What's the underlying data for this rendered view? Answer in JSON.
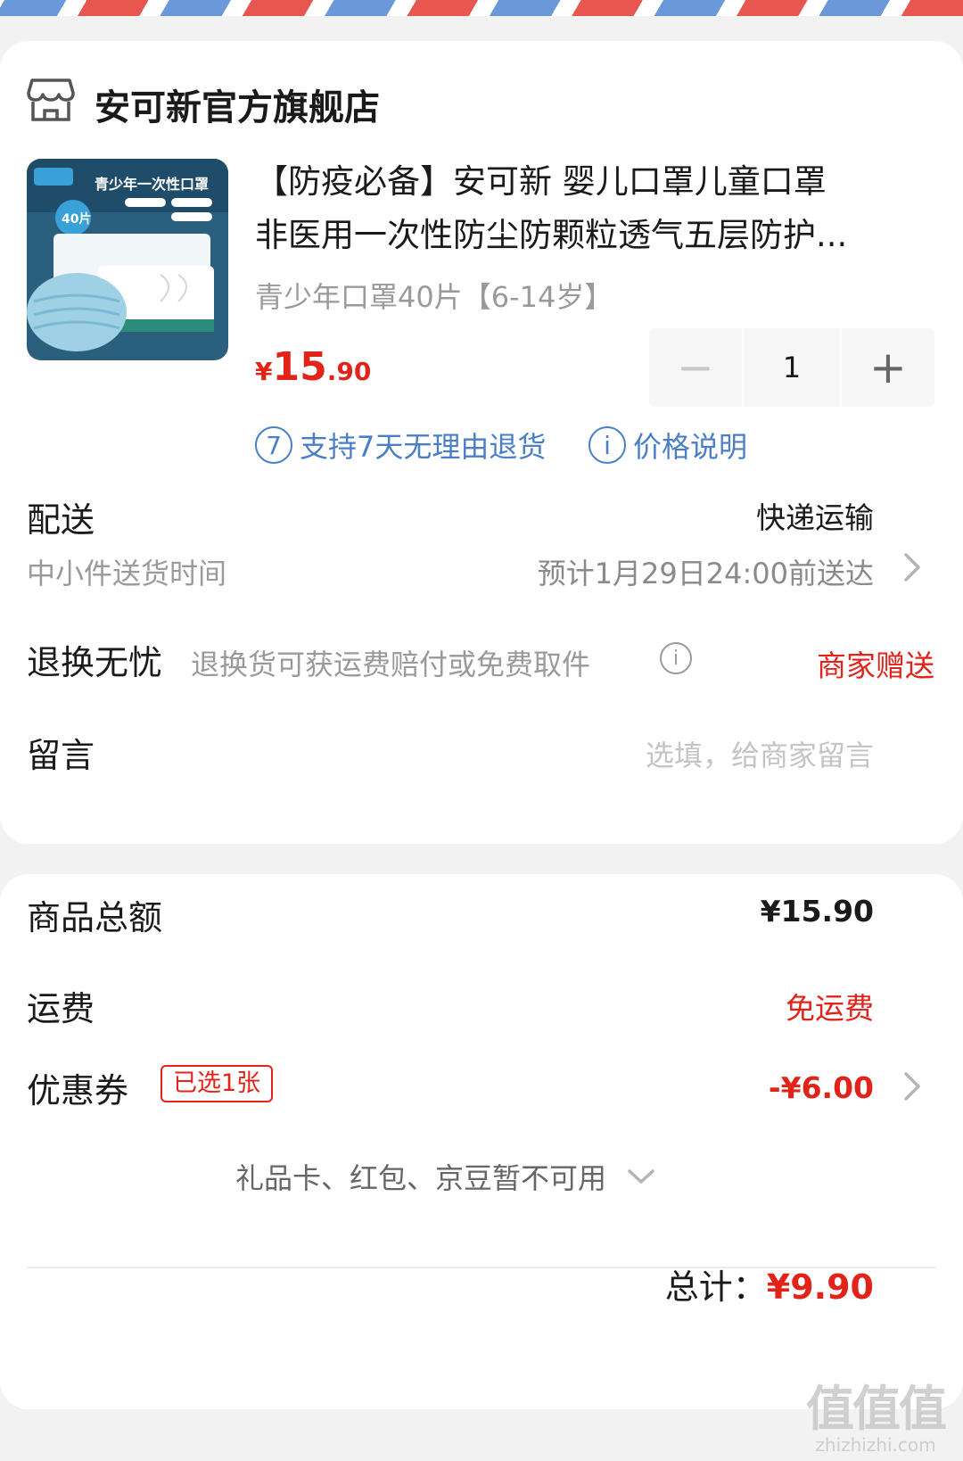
{
  "shop": {
    "name": "安可新官方旗舰店",
    "icon": "store-icon"
  },
  "product": {
    "title_line1": "【防疫必备】安可新 婴儿口罩儿童口罩",
    "title_line2": "非医用一次性防尘防颗粒透气五层防护...",
    "spec": "青少年口罩40片【6-14岁】",
    "price_yen": "¥",
    "price_int": "15",
    "price_dec": ".90",
    "quantity": "1",
    "minus_label": "−",
    "plus_label": "+",
    "thumb": {
      "pack_label": "青少年一次性口罩",
      "count_badge": "40片"
    },
    "services": [
      {
        "icon_text": "7",
        "label": "支持7天无理由退货"
      },
      {
        "icon_text": "i",
        "label": "价格说明"
      }
    ]
  },
  "delivery": {
    "label": "配送",
    "method": "快递运输",
    "sub_label": "中小件送货时间",
    "eta": "预计1月29日24:00前送达"
  },
  "returns": {
    "label": "退换无忧",
    "desc": "退换货可获运费赔付或免费取件",
    "info_icon": "i",
    "badge": "商家赠送"
  },
  "message": {
    "label": "留言",
    "placeholder": "选填，给商家留言"
  },
  "summary": {
    "goods_total_label": "商品总额",
    "goods_total": "¥15.90",
    "shipping_label": "运费",
    "shipping_value": "免运费",
    "coupon_label": "优惠券",
    "coupon_tag": "已选1张",
    "coupon_value": "-¥6.00",
    "unavailable": "礼品卡、红包、京豆暂不可用",
    "total_label": "总计：",
    "total_value": "¥9.90"
  },
  "watermark": {
    "big": "值值值",
    "small": "zhizhizhi.com"
  },
  "colors": {
    "accent_red": "#e2231a",
    "link_blue": "#4a7fc7",
    "muted_gray": "#9a9a9a",
    "stripe_red": "#e8574f",
    "stripe_blue": "#6a98d8"
  }
}
